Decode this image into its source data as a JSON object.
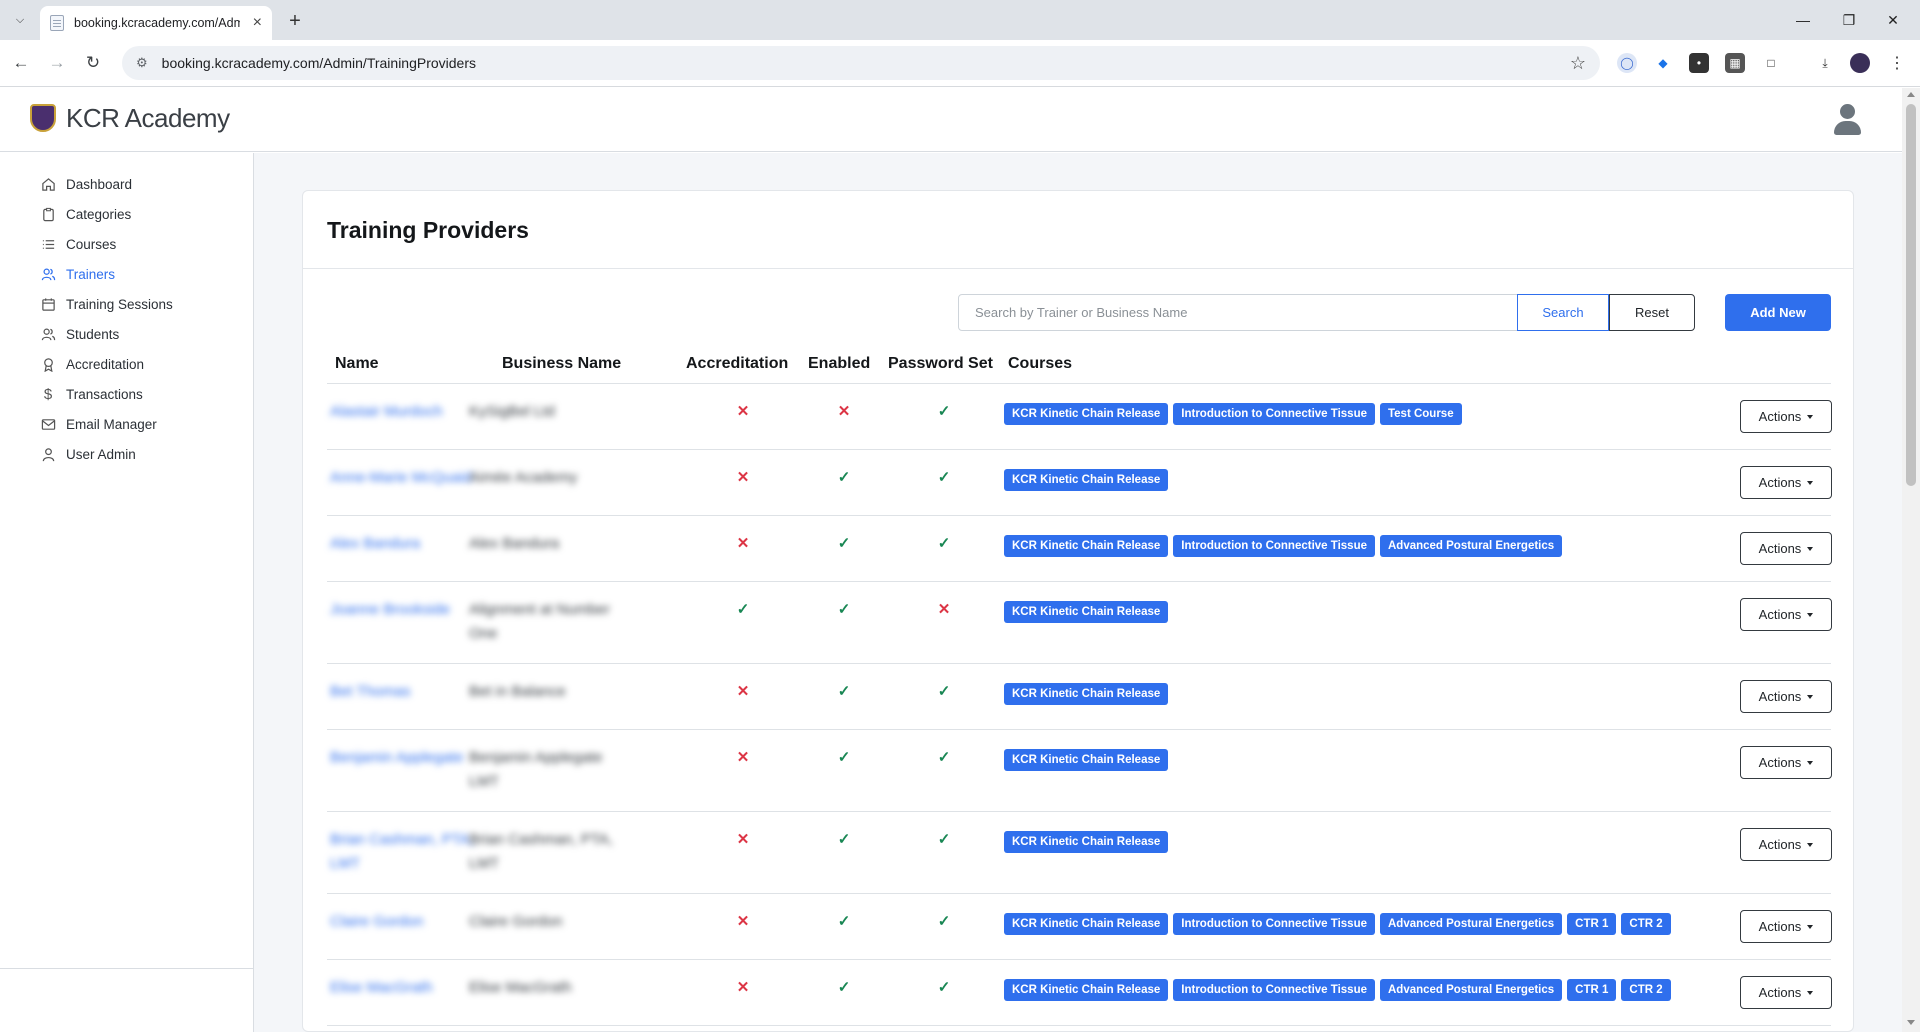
{
  "browser": {
    "tab_title": "booking.kcracademy.com/Adm",
    "url": "booking.kcracademy.com/Admin/TrainingProviders"
  },
  "app": {
    "brand": "KCR Academy"
  },
  "sidebar": {
    "items": [
      {
        "label": "Dashboard",
        "icon": "home-icon"
      },
      {
        "label": "Categories",
        "icon": "clipboard-icon"
      },
      {
        "label": "Courses",
        "icon": "list-icon"
      },
      {
        "label": "Trainers",
        "icon": "users-icon"
      },
      {
        "label": "Training Sessions",
        "icon": "calendar-icon"
      },
      {
        "label": "Students",
        "icon": "users-icon"
      },
      {
        "label": "Accreditation",
        "icon": "award-icon"
      },
      {
        "label": "Transactions",
        "icon": "dollar-icon"
      },
      {
        "label": "Email Manager",
        "icon": "mail-icon"
      },
      {
        "label": "User Admin",
        "icon": "user-icon"
      }
    ],
    "active_index": 3
  },
  "page": {
    "title": "Training Providers",
    "search_placeholder": "Search by Trainer or Business Name",
    "search_label": "Search",
    "reset_label": "Reset",
    "add_label": "Add New"
  },
  "table": {
    "headers": [
      "Name",
      "Business Name",
      "Accreditation",
      "Enabled",
      "Password Set",
      "Courses"
    ],
    "actions_label": "Actions",
    "rows": [
      {
        "name": "Alastair Murdoch",
        "business": "KySigBel Ltd",
        "accreditation": false,
        "enabled": false,
        "password_set": true,
        "courses": [
          "KCR Kinetic Chain Release",
          "Introduction to Connective Tissue",
          "Test Course"
        ]
      },
      {
        "name": "Anne-Marie McQuaid",
        "business": "Aimée Academy",
        "accreditation": false,
        "enabled": true,
        "password_set": true,
        "courses": [
          "KCR Kinetic Chain Release"
        ]
      },
      {
        "name": "Alex Bandura",
        "business": "Alex Bandura",
        "accreditation": false,
        "enabled": true,
        "password_set": true,
        "courses": [
          "KCR Kinetic Chain Release",
          "Introduction to Connective Tissue",
          "Advanced Postural Energetics"
        ]
      },
      {
        "name": "Joanne Brookside",
        "business": "Alignment at Number One",
        "accreditation": true,
        "enabled": true,
        "password_set": false,
        "courses": [
          "KCR Kinetic Chain Release"
        ]
      },
      {
        "name": "Bet Thomas",
        "business": "Bet in Balance",
        "accreditation": false,
        "enabled": true,
        "password_set": true,
        "courses": [
          "KCR Kinetic Chain Release"
        ]
      },
      {
        "name": "Benjamin Applegate",
        "business": "Benjamin Applegate LMT",
        "accreditation": false,
        "enabled": true,
        "password_set": true,
        "courses": [
          "KCR Kinetic Chain Release"
        ]
      },
      {
        "name": "Brian Cashman, PTA, LMT",
        "business": "Brian Cashman, PTA, LMT",
        "accreditation": false,
        "enabled": true,
        "password_set": true,
        "courses": [
          "KCR Kinetic Chain Release"
        ]
      },
      {
        "name": "Claire Gordon",
        "business": "Claire Gordon",
        "accreditation": false,
        "enabled": true,
        "password_set": true,
        "courses": [
          "KCR Kinetic Chain Release",
          "Introduction to Connective Tissue",
          "Advanced Postural Energetics",
          "CTR 1",
          "CTR 2"
        ]
      },
      {
        "name": "Elise MacGrath",
        "business": "Elise MacGrath",
        "accreditation": false,
        "enabled": true,
        "password_set": true,
        "courses": [
          "KCR Kinetic Chain Release",
          "Introduction to Connective Tissue",
          "Advanced Postural Energetics",
          "CTR 1",
          "CTR 2"
        ]
      }
    ]
  },
  "colors": {
    "accent": "#2f6fed",
    "success": "#198754",
    "danger": "#dc3545"
  }
}
